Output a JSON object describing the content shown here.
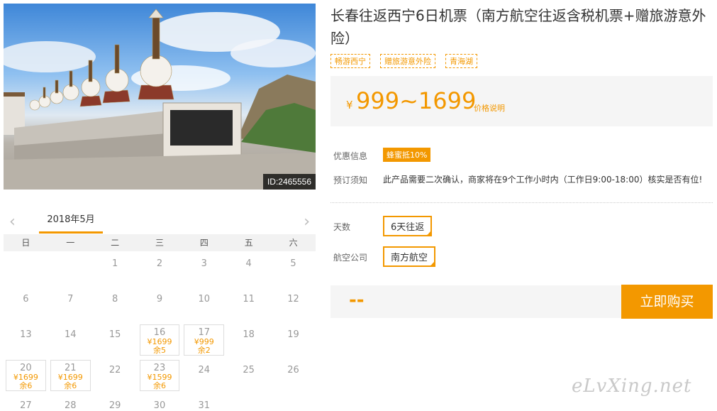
{
  "photo": {
    "id_label": "ID:2465556"
  },
  "product": {
    "title": "长春往返西宁6日机票（南方航空往返含税机票+赠旅游意外险）",
    "tags": [
      "畅游西宁",
      "赠旅游意外险",
      "青海湖"
    ]
  },
  "price": {
    "currency": "¥",
    "range": "999~1699",
    "note": "价格说明"
  },
  "promo": {
    "label": "优惠信息",
    "badge": "蜂蜜抵10%"
  },
  "booking_notice": {
    "label": "预订须知",
    "text": "此产品需要二次确认，商家将在9个工作小时内（工作日9:00-18:00）核实是否有位!"
  },
  "options": {
    "days": {
      "label": "天数",
      "value": "6天往返"
    },
    "airline": {
      "label": "航空公司",
      "value": "南方航空"
    }
  },
  "buy": {
    "total": "--",
    "button": "立即购买"
  },
  "calendar": {
    "month": "2018年5月",
    "prev_icon": "chevron-left-icon",
    "next_icon": "chevron-right-icon",
    "weekdays": [
      "日",
      "一",
      "二",
      "三",
      "四",
      "五",
      "六"
    ],
    "leading_blanks": 2,
    "days": [
      {
        "d": "1"
      },
      {
        "d": "2"
      },
      {
        "d": "3"
      },
      {
        "d": "4"
      },
      {
        "d": "5"
      },
      {
        "d": "6"
      },
      {
        "d": "7"
      },
      {
        "d": "8"
      },
      {
        "d": "9"
      },
      {
        "d": "10"
      },
      {
        "d": "11"
      },
      {
        "d": "12"
      },
      {
        "d": "13"
      },
      {
        "d": "14"
      },
      {
        "d": "15"
      },
      {
        "d": "16",
        "price": "¥1699",
        "remain": "余5"
      },
      {
        "d": "17",
        "price": "¥999",
        "remain": "余2"
      },
      {
        "d": "18"
      },
      {
        "d": "19"
      },
      {
        "d": "20",
        "price": "¥1699",
        "remain": "余6"
      },
      {
        "d": "21",
        "price": "¥1699",
        "remain": "余6"
      },
      {
        "d": "22"
      },
      {
        "d": "23",
        "price": "¥1599",
        "remain": "余6"
      },
      {
        "d": "24"
      },
      {
        "d": "25"
      },
      {
        "d": "26"
      },
      {
        "d": "27"
      },
      {
        "d": "28"
      },
      {
        "d": "29"
      },
      {
        "d": "30"
      },
      {
        "d": "31"
      }
    ]
  },
  "watermark": "eLvXing.net",
  "colors": {
    "accent": "#f39800",
    "panel": "#f5f5f5"
  }
}
